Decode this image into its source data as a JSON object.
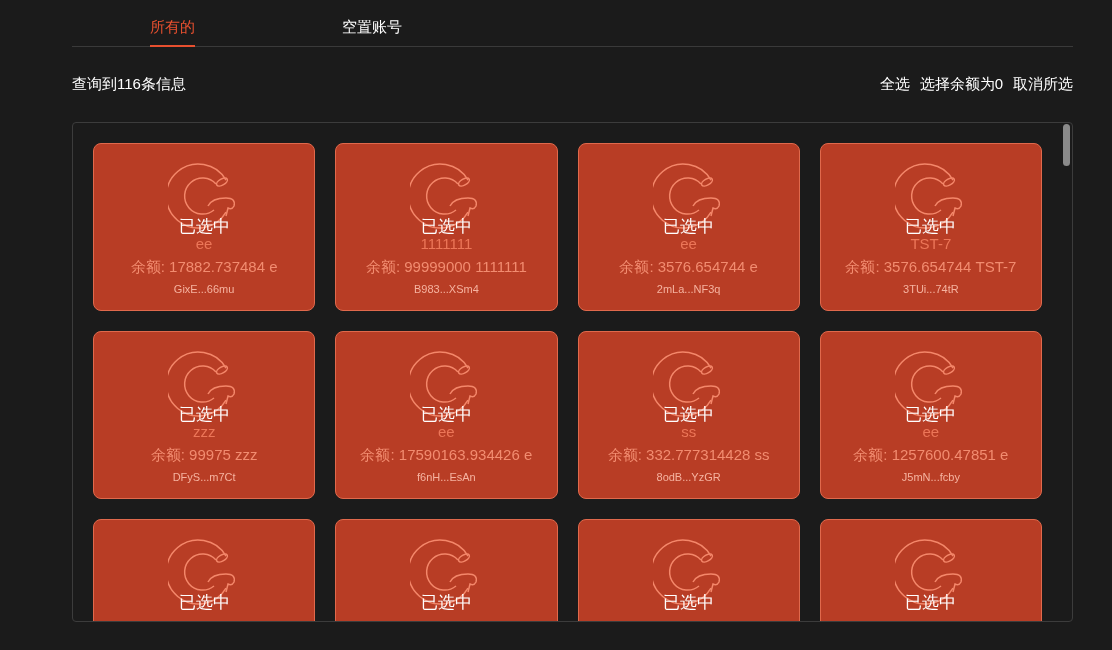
{
  "tabs": [
    {
      "label": "所有的",
      "selected": true
    },
    {
      "label": "空置账号",
      "selected": false
    }
  ],
  "summary": "查询到116条信息",
  "actions": [
    "全选",
    "选择余额为0",
    "取消所选"
  ],
  "cards": [
    {
      "selected": true,
      "status_label": "已选中",
      "name": "ee",
      "balance": "余额: 17882.737484 e",
      "address": "GixE...66mu"
    },
    {
      "selected": true,
      "status_label": "已选中",
      "name": "1111111",
      "balance": "余额: 99999000 1111111",
      "address": "B983...XSm4"
    },
    {
      "selected": true,
      "status_label": "已选中",
      "name": "ee",
      "balance": "余额: 3576.654744 e",
      "address": "2mLa...NF3q"
    },
    {
      "selected": true,
      "status_label": "已选中",
      "name": "TST-7",
      "balance": "余额: 3576.654744 TST-7",
      "address": "3TUi...74tR"
    },
    {
      "selected": true,
      "status_label": "已选中",
      "name": "zzz",
      "balance": "余额: 99975 zzz",
      "address": "DFyS...m7Ct"
    },
    {
      "selected": true,
      "status_label": "已选中",
      "name": "ee",
      "balance": "余额: 17590163.934426 e",
      "address": "f6nH...EsAn"
    },
    {
      "selected": true,
      "status_label": "已选中",
      "name": "ss",
      "balance": "余额: 332.777314428 ss",
      "address": "8odB...YzGR"
    },
    {
      "selected": true,
      "status_label": "已选中",
      "name": "ee",
      "balance": "余额: 1257600.47851 e",
      "address": "J5mN...fcby"
    },
    {
      "selected": true,
      "status_label": "已选中"
    },
    {
      "selected": true,
      "status_label": "已选中"
    },
    {
      "selected": true,
      "status_label": "已选中"
    },
    {
      "selected": true,
      "status_label": "已选中"
    }
  ]
}
